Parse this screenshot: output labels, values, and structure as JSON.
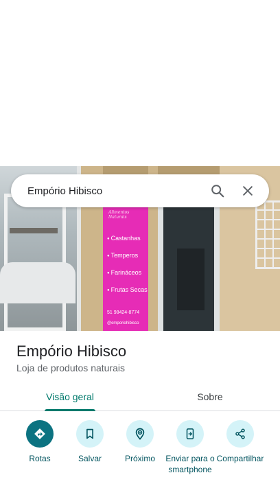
{
  "search": {
    "query": "Empório Hibisco",
    "search_icon": "search-icon",
    "close_icon": "close-icon"
  },
  "photo": {
    "sign_brand": "Alimentos Naturais",
    "sign_items": [
      "Castanhas",
      "Temperos",
      "Farináceos",
      "Frutas Secas"
    ],
    "sign_phone": "51 98424-8774",
    "sign_instagram": "@emporiohibisco"
  },
  "place": {
    "title": "Empório Hibisco",
    "category": "Loja de produtos naturais"
  },
  "tabs": [
    {
      "label": "Visão geral",
      "active": true
    },
    {
      "label": "Sobre",
      "active": false
    }
  ],
  "actions": [
    {
      "label": "Rotas",
      "icon": "directions-icon"
    },
    {
      "label": "Salvar",
      "icon": "bookmark-icon"
    },
    {
      "label": "Próximo",
      "icon": "nearby-icon"
    },
    {
      "label": "Enviar para o smartphone",
      "icon": "send-to-phone-icon"
    },
    {
      "label": "Compartilhar",
      "icon": "share-icon"
    }
  ],
  "colors": {
    "accent": "#00796b",
    "primary_button": "#0c7381",
    "secondary_button": "#d4f3f8",
    "action_label": "#00535e",
    "sign_pink": "#e62cb6"
  }
}
